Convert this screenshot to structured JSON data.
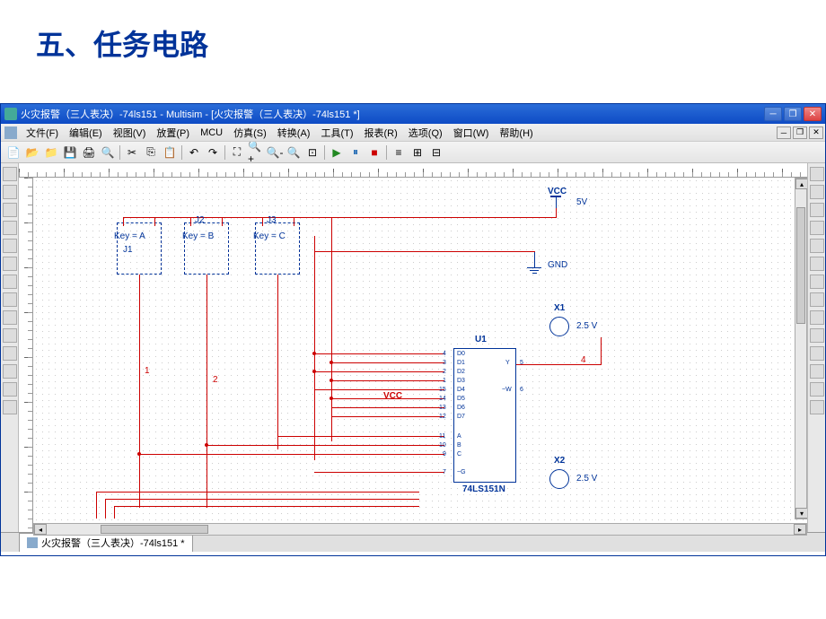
{
  "slide": {
    "title": "五、任务电路"
  },
  "window": {
    "title": "火灾报警（三人表决）-74ls151 - Multisim - [火灾报警（三人表决）-74ls151 *]"
  },
  "menu": {
    "file": "文件(F)",
    "edit": "编辑(E)",
    "view": "视图(V)",
    "place": "放置(P)",
    "mcu": "MCU",
    "simulate": "仿真(S)",
    "transfer": "转换(A)",
    "tools": "工具(T)",
    "report": "报表(R)",
    "options": "选项(Q)",
    "window": "窗口(W)",
    "help": "帮助(H)"
  },
  "tab": {
    "label": "火灾报警（三人表决）-74ls151 *"
  },
  "circuit": {
    "vcc_label": "VCC",
    "vcc_value": "5V",
    "gnd_label": "GND",
    "key_a": "Key = A",
    "key_b": "Key = B",
    "key_c": "Key = C",
    "j1": "J1",
    "j2": "J2",
    "j3": "J3",
    "wire1": "1",
    "wire2": "2",
    "wire4": "4",
    "u1": "U1",
    "chip_name": "74LS151N",
    "x1": "X1",
    "x1_v": "2.5 V",
    "x2": "X2",
    "x2_v": "2.5 V",
    "vcc_inner": "VCC",
    "pins": {
      "d0": "D0",
      "d1": "D1",
      "d2": "D2",
      "d3": "D3",
      "d4": "D4",
      "d5": "D5",
      "d6": "D6",
      "d7": "D7",
      "a": "A",
      "b": "B",
      "c": "C",
      "g": "~G",
      "y": "Y",
      "w": "~W"
    },
    "pin_nums": {
      "p4": "4",
      "p3": "3",
      "p2": "2",
      "p1": "1",
      "p15": "15",
      "p14": "14",
      "p13": "13",
      "p12": "12",
      "p11": "11",
      "p10": "10",
      "p9": "9",
      "p7": "7",
      "p5": "5",
      "p6": "6"
    }
  }
}
